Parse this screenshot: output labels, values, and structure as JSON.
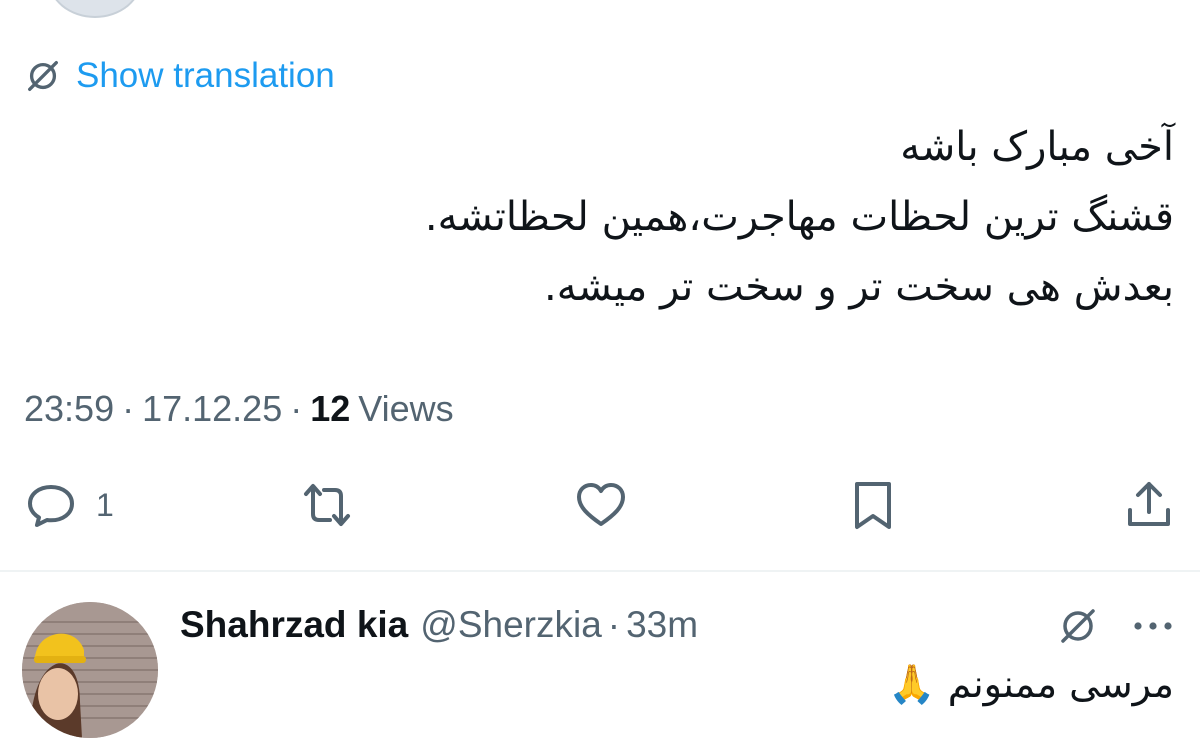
{
  "translation": {
    "label": "Show translation",
    "icon": "translate-icon"
  },
  "tweet": {
    "lines": [
      "آخی مبارک باشه",
      "قشنگ ترین لحظات مهاجرت،همین لحظاتشه.",
      "بعدش هی سخت تر و سخت تر میشه."
    ],
    "time": "23:59",
    "date": "17.12.25",
    "views_count": "12",
    "views_label": "Views",
    "separator": "·"
  },
  "actions": {
    "reply_count": "1",
    "icons": [
      "reply-icon",
      "retweet-icon",
      "like-icon",
      "bookmark-icon",
      "share-icon"
    ]
  },
  "reply": {
    "name": "Shahrzad kia",
    "handle": "@Sherzkia",
    "separator": "·",
    "time": "33m",
    "text": "مرسی ممنونم 🙏",
    "more_icon": "more-icon"
  },
  "colors": {
    "link": "#1d9bf0",
    "text": "#0f1419",
    "secondary": "#536471",
    "divider": "#eff3f4"
  }
}
